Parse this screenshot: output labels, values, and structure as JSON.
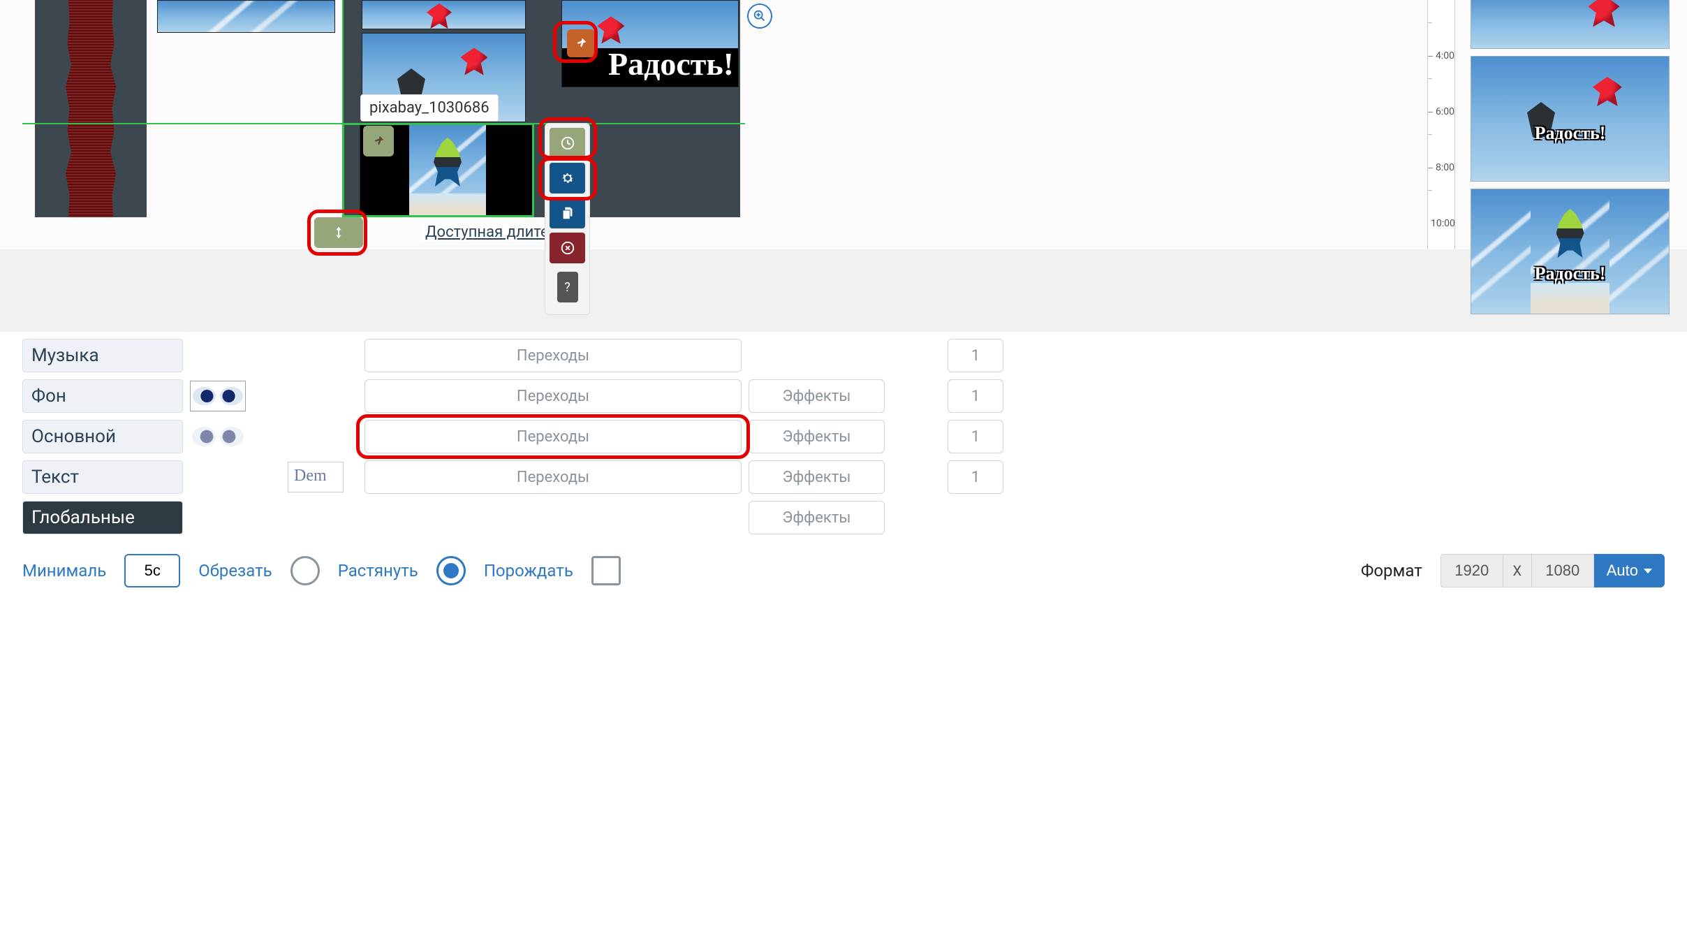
{
  "timeline": {
    "clip_tooltip": "pixabay_1030686",
    "duration_link": "Доступная длител",
    "overlay_text": "Радость!",
    "ruler": [
      "4:00",
      "6:00",
      "8:00",
      "10:00"
    ]
  },
  "previews": {
    "overlay_text": "Радость!"
  },
  "tracks": [
    {
      "label": "Музыка",
      "transitions": "Переходы",
      "effects": null,
      "count": "1"
    },
    {
      "label": "Фон",
      "transitions": "Переходы",
      "effects": "Эффекты",
      "count": "1"
    },
    {
      "label": "Основной",
      "transitions": "Переходы",
      "effects": "Эффекты",
      "count": "1"
    },
    {
      "label": "Текст",
      "transitions": "Переходы",
      "effects": "Эффекты",
      "count": "1"
    },
    {
      "label": "Глобальные",
      "transitions": null,
      "effects": "Эффекты",
      "count": null
    }
  ],
  "demo_thumb_text": "Dem",
  "footer": {
    "min_label": "Минималь",
    "min_value": "5с",
    "crop_label": "Обрезать",
    "stretch_label": "Растянуть",
    "wait_label": "Порождать",
    "format_label": "Формат",
    "width": "1920",
    "sep": "X",
    "height": "1080",
    "auto_label": "Auto"
  }
}
